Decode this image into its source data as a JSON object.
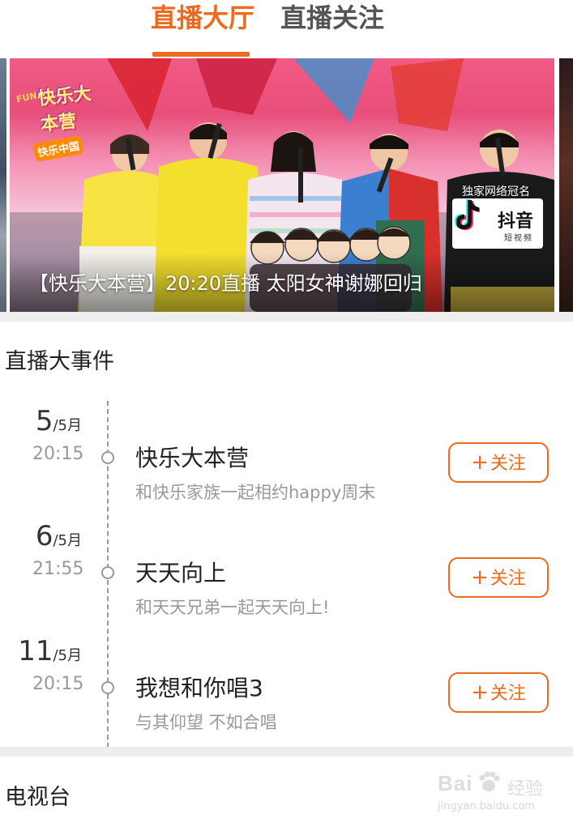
{
  "theme": {
    "accent": "#ee6a1e",
    "tab_inactive": "#555555"
  },
  "tabs": [
    {
      "label": "直播大厅",
      "active": true
    },
    {
      "label": "直播关注",
      "active": false
    }
  ],
  "banner": {
    "title": "【快乐大本营】20:20直播 太阳女神谢娜回归",
    "show_logo_fun": "FUN",
    "show_logo_main": "快乐大本营",
    "side_logo": "快乐中国",
    "sponsor_caption": "独家网络冠名",
    "sponsor_name": "抖音",
    "sponsor_sub": "短视频"
  },
  "events_section": {
    "title": "直播大事件",
    "follow_label": "关注",
    "follow_plus": "+",
    "items": [
      {
        "day": "5",
        "month": "/5月",
        "time": "20:15",
        "name": "快乐大本营",
        "desc": "和快乐家族一起相约happy周末"
      },
      {
        "day": "6",
        "month": "/5月",
        "time": "21:55",
        "name": "天天向上",
        "desc": "和天天兄弟一起天天向上!"
      },
      {
        "day": "11",
        "month": "/5月",
        "time": "20:15",
        "name": "我想和你唱3",
        "desc": "与其仰望 不如合唱"
      }
    ]
  },
  "tv_section": {
    "title": "电视台"
  },
  "watermark": {
    "main": "Bai",
    "word": "经验",
    "url": "jingyan.baidu.com"
  }
}
